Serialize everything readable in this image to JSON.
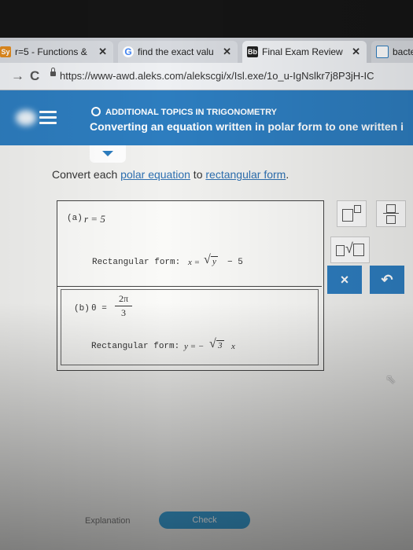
{
  "tabs": [
    {
      "favicon": "Sy",
      "label": "r=5 - Functions &"
    },
    {
      "favicon": "G",
      "label": "find the exact valu"
    },
    {
      "favicon": "Bb",
      "label": "Final Exam Review"
    },
    {
      "favicon": "",
      "label": "bacte"
    }
  ],
  "address": {
    "url": "https://www-awd.aleks.com/alekscgi/x/Isl.exe/1o_u-IgNslkr7j8P3jH-IC"
  },
  "header": {
    "topic": "ADDITIONAL TOPICS IN TRIGONOMETRY",
    "title": "Converting an equation written in polar form to one written i"
  },
  "question": {
    "prompt_prefix": "Convert each ",
    "link_polar": "polar equation",
    "prompt_mid": " to ",
    "link_rect": "rectangular form",
    "prompt_suffix": ".",
    "part_a": {
      "label": "(a)",
      "equation": "r = 5",
      "answer_label": "Rectangular form:",
      "answer_lhs": "x =",
      "answer_radicand": "y",
      "answer_rhs": "− 5"
    },
    "part_b": {
      "label": "(b)",
      "equation_lhs": "θ =",
      "frac_num": "2π",
      "frac_den": "3",
      "answer_label": "Rectangular form:",
      "answer_lhs": "y = −",
      "answer_radicand": "3",
      "answer_rhs": "x"
    }
  },
  "toolbar": {
    "clear": "×",
    "undo": "↶"
  },
  "footer": {
    "explanation": "Explanation",
    "check": "Check"
  }
}
